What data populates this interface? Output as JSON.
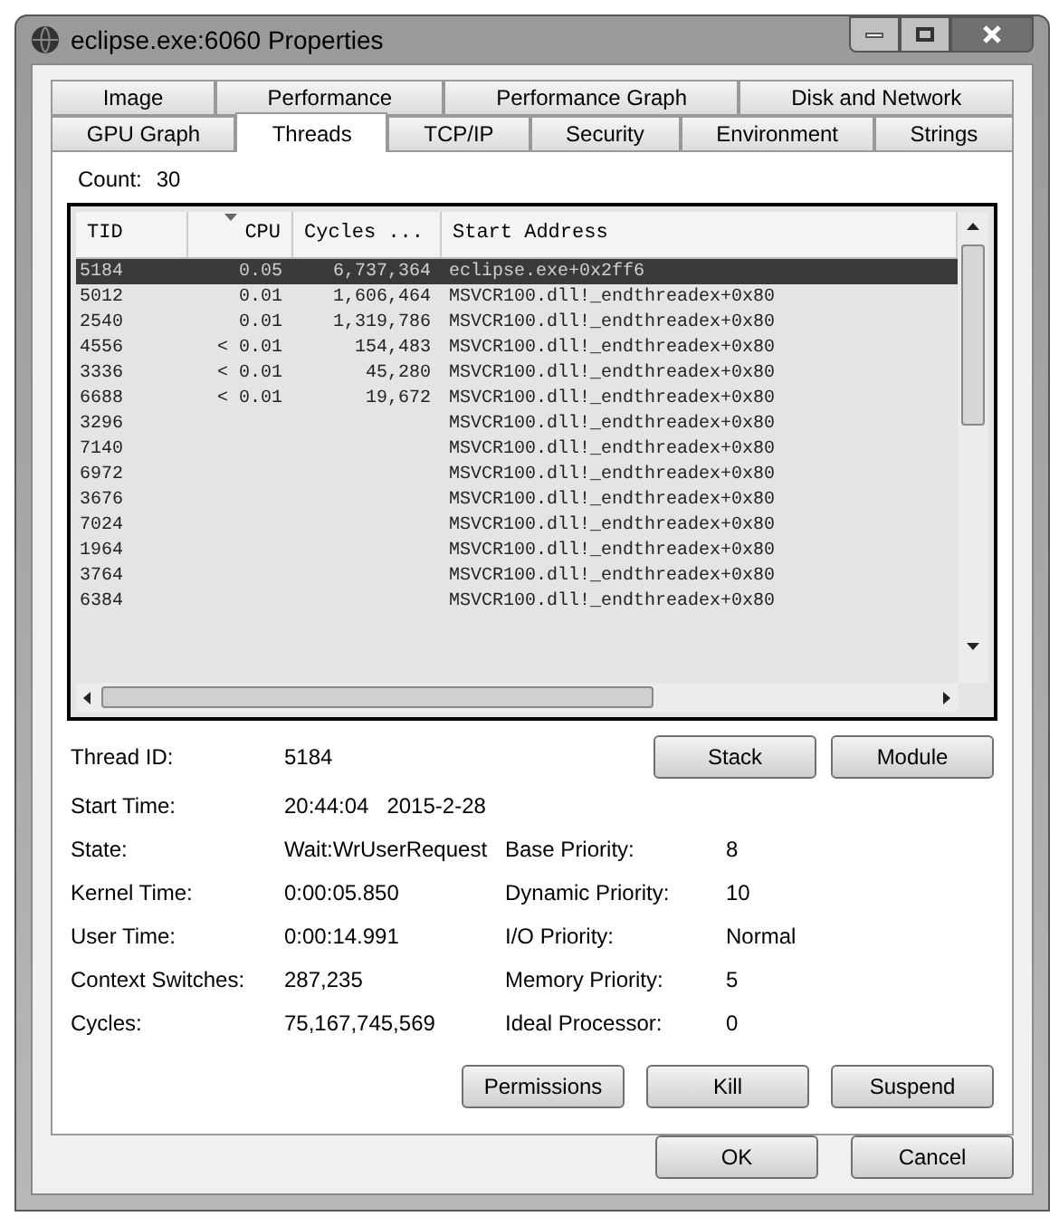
{
  "window": {
    "title": "eclipse.exe:6060 Properties"
  },
  "tab_rows": [
    [
      {
        "label": "Image",
        "selected": false
      },
      {
        "label": "Performance",
        "selected": false
      },
      {
        "label": "Performance Graph",
        "selected": false
      },
      {
        "label": "Disk and Network",
        "selected": false
      }
    ],
    [
      {
        "label": "GPU Graph",
        "selected": false
      },
      {
        "label": "Threads",
        "selected": true
      },
      {
        "label": "TCP/IP",
        "selected": false
      },
      {
        "label": "Security",
        "selected": false
      },
      {
        "label": "Environment",
        "selected": false
      },
      {
        "label": "Strings",
        "selected": false
      }
    ]
  ],
  "count": {
    "label": "Count:",
    "value": "30"
  },
  "table": {
    "columns": [
      "TID",
      "CPU",
      "Cycles ...",
      "Start Address"
    ],
    "rows": [
      {
        "tid": "5184",
        "cpu": "0.05",
        "cycles": "6,737,364",
        "address": "eclipse.exe+0x2ff6",
        "selected": true
      },
      {
        "tid": "5012",
        "cpu": "0.01",
        "cycles": "1,606,464",
        "address": "MSVCR100.dll!_endthreadex+0x80",
        "selected": false
      },
      {
        "tid": "2540",
        "cpu": "0.01",
        "cycles": "1,319,786",
        "address": "MSVCR100.dll!_endthreadex+0x80",
        "selected": false
      },
      {
        "tid": "4556",
        "cpu": "< 0.01",
        "cycles": "154,483",
        "address": "MSVCR100.dll!_endthreadex+0x80",
        "selected": false
      },
      {
        "tid": "3336",
        "cpu": "< 0.01",
        "cycles": "45,280",
        "address": "MSVCR100.dll!_endthreadex+0x80",
        "selected": false
      },
      {
        "tid": "6688",
        "cpu": "< 0.01",
        "cycles": "19,672",
        "address": "MSVCR100.dll!_endthreadex+0x80",
        "selected": false
      },
      {
        "tid": "3296",
        "address": "MSVCR100.dll!_endthreadex+0x80",
        "selected": false
      },
      {
        "tid": "7140",
        "address": "MSVCR100.dll!_endthreadex+0x80",
        "selected": false
      },
      {
        "tid": "6972",
        "address": "MSVCR100.dll!_endthreadex+0x80",
        "selected": false
      },
      {
        "tid": "3676",
        "address": "MSVCR100.dll!_endthreadex+0x80",
        "selected": false
      },
      {
        "tid": "7024",
        "address": "MSVCR100.dll!_endthreadex+0x80",
        "selected": false
      },
      {
        "tid": "1964",
        "address": "MSVCR100.dll!_endthreadex+0x80",
        "selected": false
      },
      {
        "tid": "3764",
        "address": "MSVCR100.dll!_endthreadex+0x80",
        "selected": false
      },
      {
        "tid": "6384",
        "address": "MSVCR100.dll!_endthreadex+0x80",
        "selected": false
      }
    ]
  },
  "details": [
    {
      "label": "Thread ID:",
      "value": "5184"
    },
    {
      "label": "Start Time:",
      "value": "20:44:04   2015-2-28"
    },
    {
      "label": "State:",
      "value": "Wait:WrUserRequest"
    },
    {
      "label": "Kernel Time:",
      "value": "0:00:05.850"
    },
    {
      "label": "User Time:",
      "value": "0:00:14.991"
    },
    {
      "label": "Context Switches:",
      "value": "287,235"
    },
    {
      "label": "Cycles:",
      "value": "75,167,745,569"
    }
  ],
  "priorities": [
    {
      "label": "Base Priority:",
      "value": "8"
    },
    {
      "label": "Dynamic Priority:",
      "value": "10"
    },
    {
      "label": "I/O Priority:",
      "value": "Normal"
    },
    {
      "label": "Memory Priority:",
      "value": "5"
    },
    {
      "label": "Ideal Processor:",
      "value": "0"
    }
  ],
  "thread_buttons": [
    "Stack",
    "Module"
  ],
  "action_buttons": [
    "Permissions",
    "Kill",
    "Suspend"
  ],
  "dialog_buttons": [
    "OK",
    "Cancel"
  ]
}
